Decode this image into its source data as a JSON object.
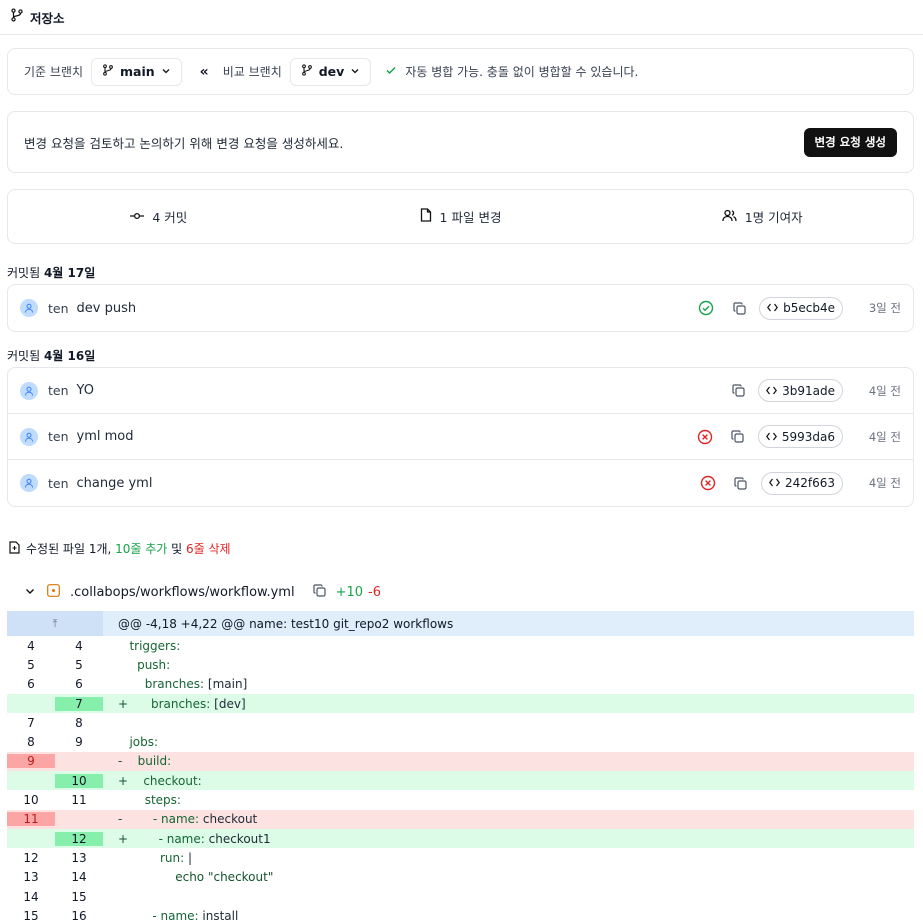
{
  "header": {
    "title": "저장소"
  },
  "compare": {
    "base_label": "기준 브랜치",
    "base_branch": "main",
    "arrows": "«",
    "compare_label": "비교 브랜치",
    "compare_branch": "dev",
    "merge_status": "자동 병합 가능. 충돌 없이 병합할 수 있습니다."
  },
  "request": {
    "message": "변경 요청을 검토하고 논의하기 위해 변경 요청을 생성하세요.",
    "button": "변경 요청 생성"
  },
  "stats": {
    "commits": "4 커밋",
    "files": "1 파일 변경",
    "contributors": "1명 기여자"
  },
  "groups": [
    {
      "prefix": "커밋됨 ",
      "date": "4월 17일",
      "commits": [
        {
          "author": "ten",
          "message": "dev push",
          "status": "success",
          "sha": "b5ecb4e",
          "ago": "3일 전"
        }
      ]
    },
    {
      "prefix": "커밋됨 ",
      "date": "4월 16일",
      "commits": [
        {
          "author": "ten",
          "message": "YO",
          "status": "none",
          "sha": "3b91ade",
          "ago": "4일 전"
        },
        {
          "author": "ten",
          "message": "yml mod",
          "status": "failed",
          "sha": "5993da6",
          "ago": "4일 전"
        },
        {
          "author": "ten",
          "message": "change yml",
          "status": "failed",
          "sha": "242f663",
          "ago": "4일 전"
        }
      ]
    }
  ],
  "summary": {
    "prefix": "수정된 파일 1개, ",
    "added": "10줄 추가",
    "mid": " 및 ",
    "deleted": "6줄 삭제"
  },
  "file": {
    "name": ".collabops/workflows/workflow.yml",
    "additions": "+10",
    "deletions": "-6"
  },
  "diff": {
    "hunk": "@@ -4,18 +4,22 @@ name: test10 git_repo2 workflows",
    "lines": [
      {
        "type": "ctx",
        "old": "4",
        "new": "4",
        "sign": " ",
        "text": "triggers:",
        "indent": "  "
      },
      {
        "type": "ctx",
        "old": "5",
        "new": "5",
        "sign": " ",
        "text": "push:",
        "indent": "    "
      },
      {
        "type": "ctx",
        "old": "6",
        "new": "6",
        "sign": " ",
        "text": "branches: [main]",
        "indent": "      "
      },
      {
        "type": "add",
        "old": "",
        "new": "7",
        "sign": "+",
        "text": "branches: [dev]",
        "indent": "      "
      },
      {
        "type": "ctx",
        "old": "7",
        "new": "8",
        "sign": " ",
        "text": "",
        "indent": ""
      },
      {
        "type": "ctx",
        "old": "8",
        "new": "9",
        "sign": " ",
        "text": "jobs:",
        "indent": "  "
      },
      {
        "type": "del",
        "old": "9",
        "new": "",
        "sign": "-",
        "text": "build:",
        "indent": "    "
      },
      {
        "type": "add",
        "old": "",
        "new": "10",
        "sign": "+",
        "text": "checkout:",
        "indent": "    "
      },
      {
        "type": "ctx",
        "old": "10",
        "new": "11",
        "sign": " ",
        "text": "steps:",
        "indent": "      "
      },
      {
        "type": "del",
        "old": "11",
        "new": "",
        "sign": "-",
        "text": "- name: checkout",
        "indent": "        "
      },
      {
        "type": "add",
        "old": "",
        "new": "12",
        "sign": "+",
        "text": "- name: checkout1",
        "indent": "        "
      },
      {
        "type": "ctx",
        "old": "12",
        "new": "13",
        "sign": " ",
        "text": "run: |",
        "indent": "          "
      },
      {
        "type": "ctx",
        "old": "13",
        "new": "14",
        "sign": " ",
        "text": "echo \"checkout\"",
        "indent": "              "
      },
      {
        "type": "ctx",
        "old": "14",
        "new": "15",
        "sign": " ",
        "text": "",
        "indent": ""
      },
      {
        "type": "ctx",
        "old": "15",
        "new": "16",
        "sign": " ",
        "text": "- name: install",
        "indent": "        "
      }
    ]
  },
  "colors": {
    "success": "#16a34a",
    "failed": "#dc2626",
    "accent": "#111111"
  }
}
